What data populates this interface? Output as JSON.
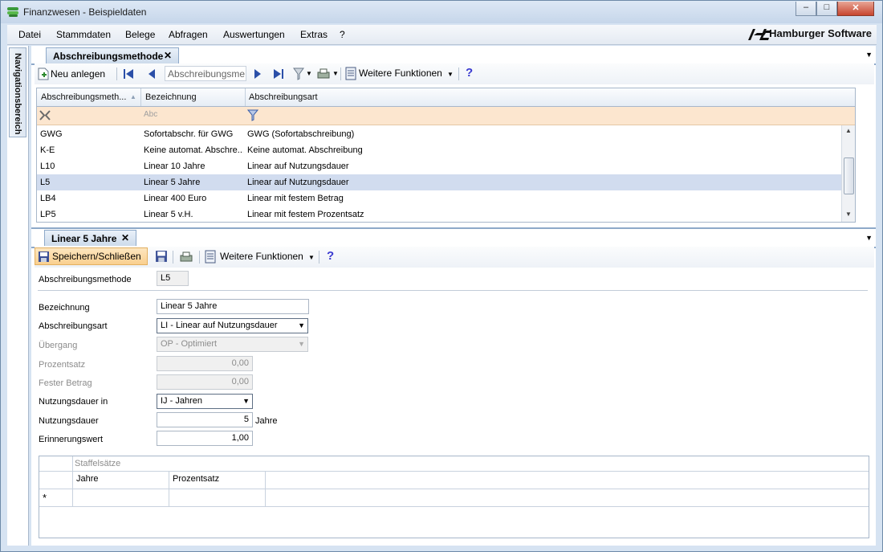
{
  "window": {
    "title": "Finanzwesen - Beispieldaten",
    "buttons": [
      "–",
      "□",
      "✕"
    ]
  },
  "menu": {
    "items": [
      "Datei",
      "Stammdaten",
      "Belege",
      "Abfragen",
      "Auswertungen",
      "Extras",
      "?"
    ],
    "brand": "Hamburger Software",
    "brand_logo": "hs"
  },
  "nav": {
    "label": "Navigationsbereich"
  },
  "list_panel": {
    "tab_label": "Abschreibungsmethode",
    "toolbar": {
      "new_label": "Neu anlegen",
      "search_value": "Abschreibungsme",
      "more_label": "Weitere Funktionen"
    },
    "columns": [
      "Abschreibungsmeth...",
      "Bezeichnung",
      "Abschreibungsart"
    ],
    "filter_placeholder": "Abc",
    "rows": [
      [
        "GWG",
        "Sofortabschr. für GWG",
        "GWG (Sofortabschreibung)"
      ],
      [
        "K-E",
        "Keine automat. Abschre...",
        "Keine automat. Abschreibung"
      ],
      [
        "L10",
        "Linear 10 Jahre",
        "Linear auf Nutzungsdauer"
      ],
      [
        "L5",
        "Linear 5 Jahre",
        "Linear auf Nutzungsdauer"
      ],
      [
        "LB4",
        "Linear 400 Euro",
        "Linear mit festem Betrag"
      ],
      [
        "LP5",
        "Linear 5 v.H.",
        "Linear mit festem Prozentsatz"
      ]
    ],
    "selected_row": 3
  },
  "detail_panel": {
    "tab_label": "Linear 5 Jahre",
    "toolbar": {
      "save_close_label": "Speichern/Schließen",
      "more_label": "Weitere Funktionen"
    },
    "fields": {
      "method_label": "Abschreibungsmethode",
      "method_value": "L5",
      "name_label": "Bezeichnung",
      "name_value": "Linear 5 Jahre",
      "type_label": "Abschreibungsart",
      "type_value": "LI - Linear auf Nutzungsdauer",
      "transition_label": "Übergang",
      "transition_value": "OP - Optimiert",
      "percent_label": "Prozentsatz",
      "percent_value": "0,00",
      "fixed_label": "Fester Betrag",
      "fixed_value": "0,00",
      "life_unit_label": "Nutzungsdauer in",
      "life_unit_value": "IJ - Jahren",
      "life_label": "Nutzungsdauer",
      "life_value": "5",
      "life_suffix": "Jahre",
      "reminder_label": "Erinnerungswert",
      "reminder_value": "1,00"
    },
    "staffel": {
      "title": "Staffelsätze",
      "columns": [
        "Jahre",
        "Prozentsatz"
      ],
      "new_row_marker": "*"
    }
  },
  "colors": {
    "selection": "#d1dcef",
    "filter_row": "#fce6cf",
    "tab_border": "#8ea9c9"
  }
}
